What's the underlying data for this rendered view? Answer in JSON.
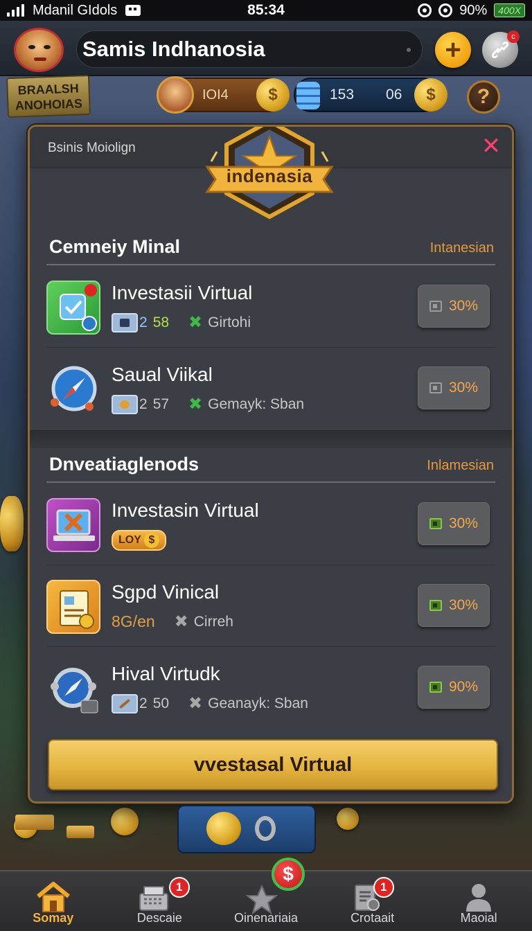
{
  "status_bar": {
    "carrier": "Mdanil GIdols",
    "time": "85:34",
    "battery_percent": "90%",
    "battery_label": "400X"
  },
  "header": {
    "title": "Samis Indhanosia"
  },
  "resources": {
    "sign_text": "BRAALSH ANOHOIAS",
    "res1_value": "IOI4",
    "res2_value_a": "153",
    "res2_value_b": "06"
  },
  "modal": {
    "subtitle": "Bsinis Moiolign",
    "emblem_label": "indenasia",
    "close_icon": "close-icon",
    "sections": [
      {
        "title": "Cemneiy Minal",
        "tag": "Intanesian",
        "rows": [
          {
            "title": "Investasii Virtual",
            "meta_num": "2",
            "meta_value": "58",
            "meta_tag": "Girtohi",
            "button": "30%"
          },
          {
            "title": "Saual Viikal",
            "meta_num": "2",
            "meta_value": "57",
            "meta_tag": "Gemayk: Sban",
            "button": "30%"
          }
        ]
      },
      {
        "title": "Dnveatiaglenods",
        "tag": "Inlamesian",
        "rows": [
          {
            "title": "Investasin Virtual",
            "meta_tag": "LOY",
            "button": "30%"
          },
          {
            "title": "Sgpd Vinical",
            "meta_value": "8G/en",
            "meta_tag": "Cirreh",
            "button": "30%"
          },
          {
            "title": "Hival Virtudk",
            "meta_num": "2",
            "meta_value": "50",
            "meta_tag": "Geanayk: Sban",
            "button": "90%"
          }
        ]
      }
    ],
    "cta_label": "vvestasal Virtual"
  },
  "bottom_nav": [
    {
      "label": "Somay",
      "icon": "home-icon",
      "active": true
    },
    {
      "label": "Descaie",
      "icon": "cash-register-icon",
      "badge": "1"
    },
    {
      "label": "Oinenariaia",
      "icon": "star-icon",
      "badge": "$"
    },
    {
      "label": "Crotaait",
      "icon": "document-icon",
      "badge": "1"
    },
    {
      "label": "Maoial",
      "icon": "person-icon"
    }
  ],
  "colors": {
    "accent_gold": "#e2b23c",
    "tag_orange": "#e89a3a",
    "close_pink": "#ff3d6e",
    "nav_active": "#f4b43a"
  }
}
